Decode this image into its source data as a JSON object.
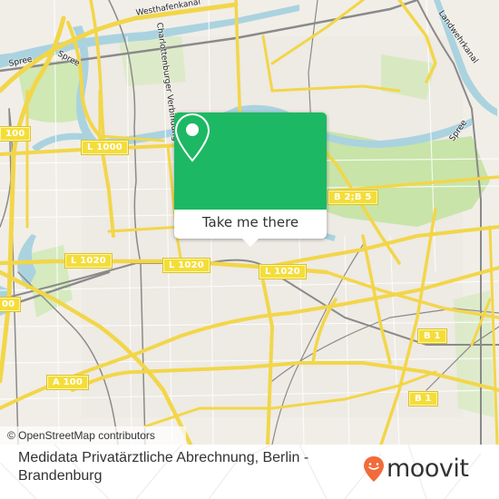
{
  "map": {
    "road_labels": [
      {
        "text": "100"
      },
      {
        "text": "L 1000"
      },
      {
        "text": "B 2;B 5"
      },
      {
        "text": "L 1020"
      },
      {
        "text": "L 1020"
      },
      {
        "text": "L 1020"
      },
      {
        "text": "00"
      },
      {
        "text": "A 100"
      },
      {
        "text": "B 1"
      },
      {
        "text": "B 1"
      }
    ],
    "water_labels": [
      {
        "text": "Westhafenkanal"
      },
      {
        "text": "Spree"
      },
      {
        "text": "Spree"
      },
      {
        "text": "Spree"
      },
      {
        "text": "Landwehrkanal"
      }
    ],
    "street_labels": [
      {
        "text": "Charlottenburger Verbindung"
      }
    ],
    "colors": {
      "land": "#f1eee8",
      "water": "#aad3df",
      "park": "#c8e4a9",
      "road_major": "#f7e26b",
      "rail": "#8a8a8a"
    },
    "attribution": "© OpenStreetMap contributors"
  },
  "popup": {
    "icon": "map-pin-icon",
    "button_label": "Take me there",
    "accent_color": "#1db864"
  },
  "footer": {
    "place_name": "Medidata Privatärztliche Abrechnung, Berlin - Brandenburg",
    "brand": "moovit",
    "brand_icon": "moovit-smiley-pin-icon",
    "brand_color": "#f26b3a"
  }
}
